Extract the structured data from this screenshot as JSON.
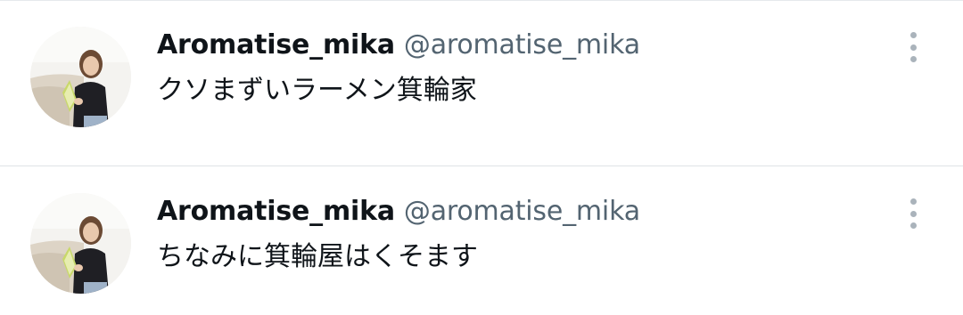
{
  "colors": {
    "text_primary": "#0f1419",
    "text_secondary": "#536471",
    "divider": "#dfe3e6",
    "more_icon": "#aab3bb"
  },
  "posts": [
    {
      "display_name": "Aromatise_mika",
      "handle": "@aromatise_mika",
      "text": "クソまずいラーメン箕輪家",
      "avatar_icon": "profile-photo",
      "menu_icon": "more-vertical-icon"
    },
    {
      "display_name": "Aromatise_mika",
      "handle": "@aromatise_mika",
      "text": "ちなみに箕輪屋はくそます",
      "avatar_icon": "profile-photo",
      "menu_icon": "more-vertical-icon"
    }
  ]
}
